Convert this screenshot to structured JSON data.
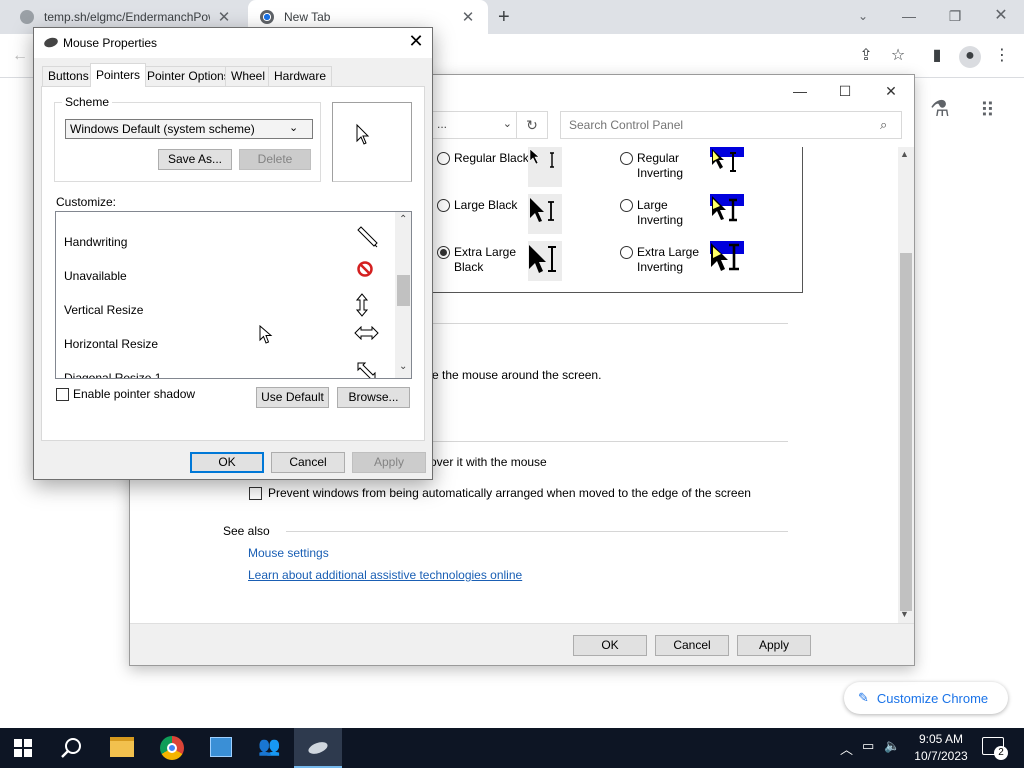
{
  "chrome": {
    "tabs": [
      {
        "title": "temp.sh/elgmc/EndermanchPow",
        "active": false
      },
      {
        "title": "New Tab",
        "active": true
      }
    ],
    "customize_label": "Customize Chrome"
  },
  "control_panel": {
    "search_placeholder": "Search Control Panel",
    "address_fragment": "...",
    "schemes": [
      {
        "label": "Regular Black",
        "selected": false
      },
      {
        "label": "Regular Inverting",
        "selected": false
      },
      {
        "label": "Large Black",
        "selected": false
      },
      {
        "label": "Large Inverting",
        "selected": false
      },
      {
        "label": "Extra Large Black",
        "selected": true
      },
      {
        "label": "Extra Large Inverting",
        "selected": false
      }
    ],
    "text_mouse_around": "e the mouse around the screen.",
    "text_hover": "over it with the mouse",
    "prevent_arrange": "Prevent windows from being automatically arranged when moved to the edge of the screen",
    "see_also": "See also",
    "mouse_settings": "Mouse settings",
    "assistive_link": "Learn about additional assistive technologies online",
    "ok": "OK",
    "cancel": "Cancel",
    "apply": "Apply"
  },
  "mouse_properties": {
    "title": "Mouse Properties",
    "tabs": [
      "Buttons",
      "Pointers",
      "Pointer Options",
      "Wheel",
      "Hardware"
    ],
    "active_tab": "Pointers",
    "scheme_label": "Scheme",
    "scheme_value": "Windows Default (system scheme)",
    "save_as": "Save As...",
    "delete": "Delete",
    "customize_label": "Customize:",
    "cursors": [
      {
        "name": "Handwriting",
        "icon": "pen-icon"
      },
      {
        "name": "Unavailable",
        "icon": "unavailable-icon"
      },
      {
        "name": "Vertical Resize",
        "icon": "vertical-resize-icon"
      },
      {
        "name": "Horizontal Resize",
        "icon": "horizontal-resize-icon"
      },
      {
        "name": "Diagonal Resize 1",
        "icon": "diagonal-resize-icon"
      }
    ],
    "enable_shadow": "Enable pointer shadow",
    "use_default": "Use Default",
    "browse": "Browse...",
    "ok": "OK",
    "cancel": "Cancel",
    "apply": "Apply"
  },
  "taskbar": {
    "time": "9:05 AM",
    "date": "10/7/2023",
    "notification_count": "2",
    "apps": [
      "start-icon",
      "search-icon",
      "file-explorer-icon",
      "chrome-icon",
      "control-panel-icon",
      "users-icon",
      "mouse-icon"
    ]
  }
}
